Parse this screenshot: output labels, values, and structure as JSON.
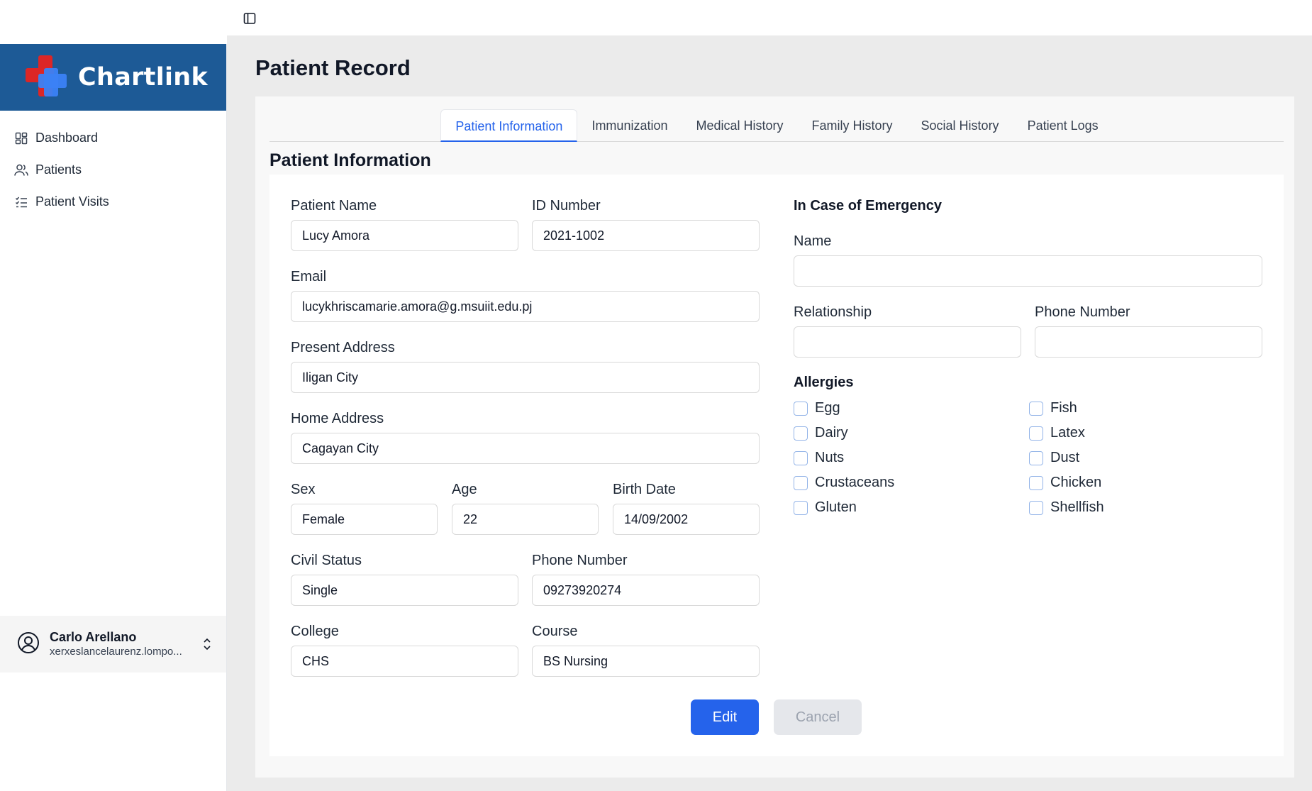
{
  "app": {
    "brand": "Chartlink",
    "colors": {
      "brand_bg": "#1d5a96",
      "accent": "#2563eb",
      "logo_red": "#dc2626",
      "logo_blue": "#3b82f6"
    }
  },
  "sidebar": {
    "items": [
      {
        "label": "Dashboard",
        "icon": "dashboard-grid-icon"
      },
      {
        "label": "Patients",
        "icon": "users-icon"
      },
      {
        "label": "Patient Visits",
        "icon": "list-check-icon"
      }
    ],
    "user": {
      "name": "Carlo Arellano",
      "email": "xerxeslancelaurenz.lompo..."
    }
  },
  "page": {
    "title": "Patient Record",
    "tabs": [
      {
        "label": "Patient Information",
        "active": true
      },
      {
        "label": "Immunization",
        "active": false
      },
      {
        "label": "Medical History",
        "active": false
      },
      {
        "label": "Family History",
        "active": false
      },
      {
        "label": "Social History",
        "active": false
      },
      {
        "label": "Patient Logs",
        "active": false
      }
    ],
    "section_title": "Patient Information"
  },
  "form": {
    "patient_name": {
      "label": "Patient Name",
      "value": "Lucy Amora"
    },
    "id_number": {
      "label": "ID Number",
      "value": "2021-1002"
    },
    "email": {
      "label": "Email",
      "value": "lucykhriscamarie.amora@g.msuiit.edu.pj"
    },
    "present_address": {
      "label": "Present Address",
      "value": "Iligan City"
    },
    "home_address": {
      "label": "Home Address",
      "value": "Cagayan City"
    },
    "sex": {
      "label": "Sex",
      "value": "Female"
    },
    "age": {
      "label": "Age",
      "value": "22"
    },
    "birth_date": {
      "label": "Birth Date",
      "value": "14/09/2002"
    },
    "civil_status": {
      "label": "Civil Status",
      "value": "Single"
    },
    "phone_number": {
      "label": "Phone Number",
      "value": "09273920274"
    },
    "college": {
      "label": "College",
      "value": "CHS"
    },
    "course": {
      "label": "Course",
      "value": "BS Nursing"
    }
  },
  "emergency": {
    "heading": "In Case of Emergency",
    "name": {
      "label": "Name",
      "value": ""
    },
    "relationship": {
      "label": "Relationship",
      "value": ""
    },
    "phone_number": {
      "label": "Phone Number",
      "value": ""
    }
  },
  "allergies": {
    "heading": "Allergies",
    "left": [
      {
        "label": "Egg",
        "checked": false
      },
      {
        "label": "Dairy",
        "checked": false
      },
      {
        "label": "Nuts",
        "checked": false
      },
      {
        "label": "Crustaceans",
        "checked": false
      },
      {
        "label": "Gluten",
        "checked": false
      }
    ],
    "right": [
      {
        "label": "Fish",
        "checked": false
      },
      {
        "label": "Latex",
        "checked": false
      },
      {
        "label": "Dust",
        "checked": false
      },
      {
        "label": "Chicken",
        "checked": false
      },
      {
        "label": "Shellfish",
        "checked": false
      }
    ]
  },
  "actions": {
    "edit_label": "Edit",
    "cancel_label": "Cancel"
  }
}
